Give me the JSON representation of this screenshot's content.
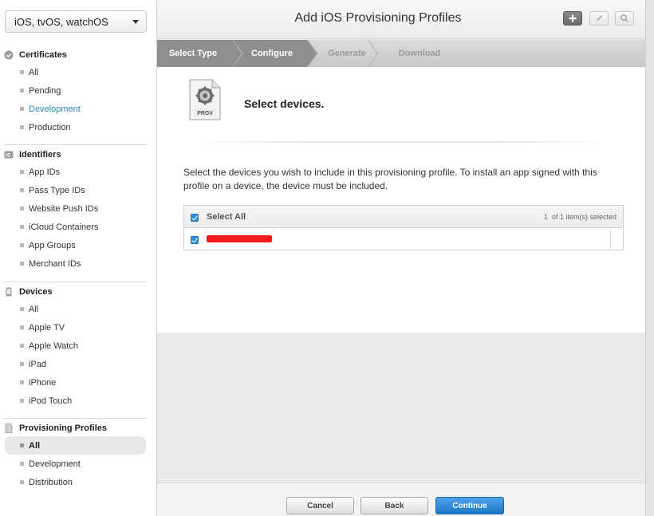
{
  "sidebar": {
    "platform_select": "iOS, tvOS, watchOS",
    "sections": [
      {
        "title": "Certificates",
        "icon": "certificate-icon",
        "items": [
          {
            "label": "All"
          },
          {
            "label": "Pending"
          },
          {
            "label": "Development",
            "state": "active"
          },
          {
            "label": "Production"
          }
        ]
      },
      {
        "title": "Identifiers",
        "icon": "id-icon",
        "items": [
          {
            "label": "App IDs"
          },
          {
            "label": "Pass Type IDs"
          },
          {
            "label": "Website Push IDs"
          },
          {
            "label": "iCloud Containers"
          },
          {
            "label": "App Groups"
          },
          {
            "label": "Merchant IDs"
          }
        ]
      },
      {
        "title": "Devices",
        "icon": "device-icon",
        "items": [
          {
            "label": "All"
          },
          {
            "label": "Apple TV"
          },
          {
            "label": "Apple Watch"
          },
          {
            "label": "iPad"
          },
          {
            "label": "iPhone"
          },
          {
            "label": "iPod Touch"
          }
        ]
      },
      {
        "title": "Provisioning Profiles",
        "icon": "profile-icon",
        "items": [
          {
            "label": "All",
            "state": "selected"
          },
          {
            "label": "Development"
          },
          {
            "label": "Distribution"
          }
        ]
      }
    ]
  },
  "header": {
    "title": "Add iOS Provisioning Profiles",
    "toolbar": [
      "add-icon",
      "edit-icon",
      "search-icon"
    ]
  },
  "steps": [
    {
      "label": "Select Type",
      "state": "done"
    },
    {
      "label": "Configure",
      "state": "done"
    },
    {
      "label": "Generate",
      "state": "pending"
    },
    {
      "label": "Download",
      "state": "pending"
    }
  ],
  "content": {
    "icon_label": "PROV",
    "heading": "Select devices.",
    "description": "Select the devices you wish to include in this provisioning profile. To install an app signed with this profile on a device, the device must be included.",
    "table": {
      "select_all_label": "Select All",
      "count": "1",
      "count_suffix": "of 1 item(s) selected",
      "rows": [
        {
          "checked": true,
          "name_redacted": true
        }
      ]
    }
  },
  "footer": {
    "cancel": "Cancel",
    "back": "Back",
    "continue": "Continue"
  },
  "colors": {
    "accent": "#2a8ab8",
    "primary_button": "#2f86d6",
    "redaction": "#ee1c1c"
  }
}
